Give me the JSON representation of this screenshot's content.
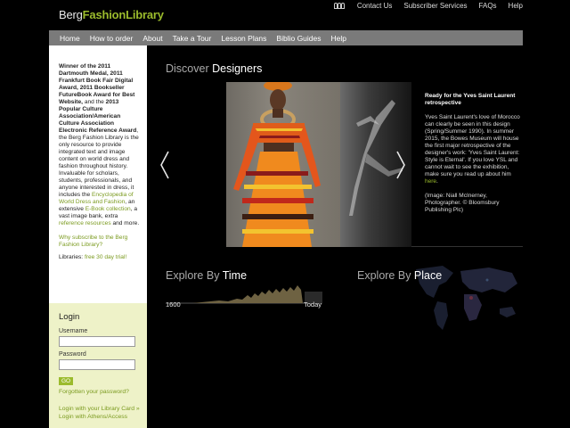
{
  "header": {
    "logo_part1": "Berg",
    "logo_part2": "FashionLibrary",
    "top_links": [
      "Contact Us",
      "Subscriber Services",
      "FAQs",
      "Help"
    ]
  },
  "nav": {
    "items": [
      "Home",
      "How to order",
      "About",
      "Take a Tour",
      "Lesson Plans",
      "Biblio Guides",
      "Help"
    ]
  },
  "sidebar": {
    "award_1": "Winner of the 2011 Dartmouth Medal, 2011 Frankfurt Book Fair Digital Award, 2011 Bookseller FutureBook Award for Best Website,",
    "award_and": " and the ",
    "award_2": "2013 Popular Culture Association/American Culture Association Electronic Reference Award",
    "desc_1": ", the Berg Fashion Library is the only resource to provide integrated text and image content on world dress and fashion throughout history. Invaluable for scholars, students, professionals, and anyone interested in dress, it includes the ",
    "encyclopedia_link": "Encyclopedia of World Dress and Fashion",
    "desc_2": ", an extensive ",
    "ebook_link": "E-Book collection",
    "desc_3": ", a vast image bank, extra ",
    "reference_link": "reference resources",
    "desc_4": " and more.",
    "why_link": "Why subscribe to the Berg Fashion Library?",
    "libraries_label": "Libraries: ",
    "trial_link": "free 30 day trial!"
  },
  "login": {
    "heading": "Login",
    "username_label": "Username",
    "username_value": "",
    "password_label": "Password",
    "password_value": "",
    "go_label": "GO",
    "forgot_link": "Forgotten your password?",
    "library_card_link": "Login with your Library Card »",
    "athens_link": "Login with Athens/Access"
  },
  "main": {
    "discover_prefix": "Discover ",
    "discover_strong": "Designers",
    "caption_title": "Ready for the Yves Saint Laurent retrospective",
    "caption_body_1": "Yves Saint Laurent's love of Morocco can clearly be seen in this design (Spring/Summer 1990). In summer 2015, the Bowes Museum will house the first major retrospective of the designer's work: 'Yves Saint Laurent: Style is Eternal'. If you love YSL and cannot wait to see the exhibition, make sure you read up about him ",
    "caption_here": "here",
    "caption_body_2": ".",
    "caption_credit": "(Image: Niall McInerney, Photographer. © Bloomsbury Publishing Plc)",
    "explore_time_prefix": "Explore By ",
    "explore_time_strong": "Time",
    "timeline_start": "1600",
    "timeline_end": "Today",
    "explore_place_prefix": "Explore By ",
    "explore_place_strong": "Place"
  },
  "colors": {
    "accent_green": "#9bbb2c",
    "nav_gray": "#7a7a7a",
    "login_bg": "#eef2c8"
  }
}
